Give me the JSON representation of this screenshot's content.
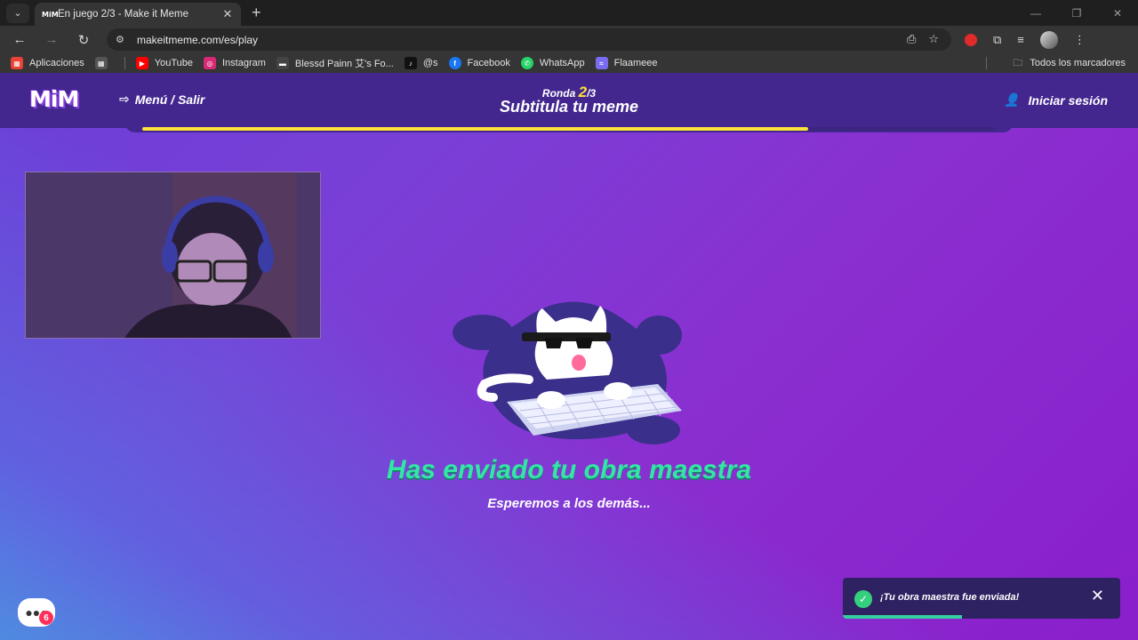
{
  "browser": {
    "tab": {
      "favicon": "MiM",
      "title": "En juego 2/3 - Make it Meme"
    },
    "url": "makeitmeme.com/es/play",
    "bookmarks": [
      {
        "label": "Aplicaciones",
        "icon": "apps-grid-icon",
        "color": "#e94235"
      },
      {
        "label": "",
        "icon": "grid-icon",
        "color": "#555"
      },
      {
        "label": "YouTube",
        "icon": "youtube-icon",
        "color": "#ff0000"
      },
      {
        "label": "Instagram",
        "icon": "instagram-icon",
        "color": "#d62976"
      },
      {
        "label": "Blessd Painn 艾's Fo...",
        "icon": "bookmark-icon",
        "color": "#444"
      },
      {
        "label": "@s",
        "icon": "tiktok-icon",
        "color": "#111"
      },
      {
        "label": "Facebook",
        "icon": "facebook-icon",
        "color": "#1877f2"
      },
      {
        "label": "WhatsApp",
        "icon": "whatsapp-icon",
        "color": "#25d366"
      },
      {
        "label": "Flaameee",
        "icon": "bookmark-icon",
        "color": "#7a6cf0"
      }
    ],
    "all_bookmarks": "Todos los marcadores"
  },
  "header": {
    "logo": "MiM",
    "menu_exit": "Menú / Salir",
    "round_label": "Ronda",
    "round_current": "2",
    "round_total": "/3",
    "round_title": "Subtitula tu meme",
    "login": "Iniciar sesión",
    "progress": 0.78
  },
  "main": {
    "sent_title": "Has enviado tu obra maestra",
    "sent_subtitle": "Esperemos a los demás..."
  },
  "chat": {
    "badge": "6"
  },
  "toast": {
    "message": "¡Tu obra maestra fue enviada!",
    "progress": 0.43
  },
  "colors": {
    "accent_green": "#34e6a6",
    "accent_yellow": "#ffe23a",
    "header_bg": "#43278f"
  }
}
